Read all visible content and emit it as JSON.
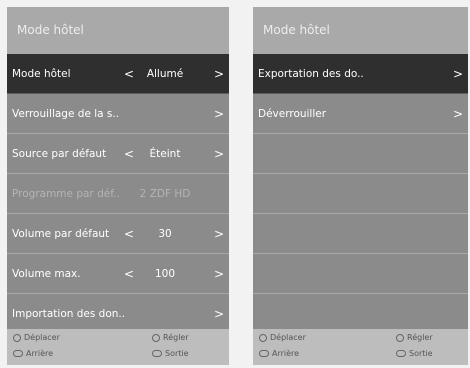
{
  "left": {
    "title": "Mode hôtel",
    "rows": [
      {
        "label": "Mode hôtel",
        "value": "Allumé",
        "left_arrow": "<",
        "right_arrow": ">"
      },
      {
        "label": "Verrouillage de la s..",
        "right_arrow": ">"
      },
      {
        "label": "Source par défaut",
        "value": "Éteint",
        "left_arrow": "<",
        "right_arrow": ">"
      },
      {
        "label": "Programme par déf..",
        "value": "2 ZDF HD"
      },
      {
        "label": "Volume par défaut",
        "value": "30",
        "left_arrow": "<",
        "right_arrow": ">"
      },
      {
        "label": "Volume max.",
        "value": "100",
        "left_arrow": "<",
        "right_arrow": ">"
      },
      {
        "label": "Importation des don..",
        "right_arrow": ">"
      }
    ],
    "footer": {
      "move": "Déplacer",
      "adjust": "Régler",
      "back": "Arrière",
      "exit": "Sortie"
    }
  },
  "right": {
    "title": "Mode hôtel",
    "rows": [
      {
        "label": "Exportation des do..",
        "right_arrow": ">"
      },
      {
        "label": "Déverrouiller",
        "right_arrow": ">"
      }
    ],
    "footer": {
      "move": "Déplacer",
      "adjust": "Régler",
      "back": "Arrière",
      "exit": "Sortie"
    }
  },
  "icons": {
    "move": "dpad-icon",
    "adjust": "ok-button-icon",
    "back": "back-button-icon",
    "exit": "exit-button-icon"
  }
}
